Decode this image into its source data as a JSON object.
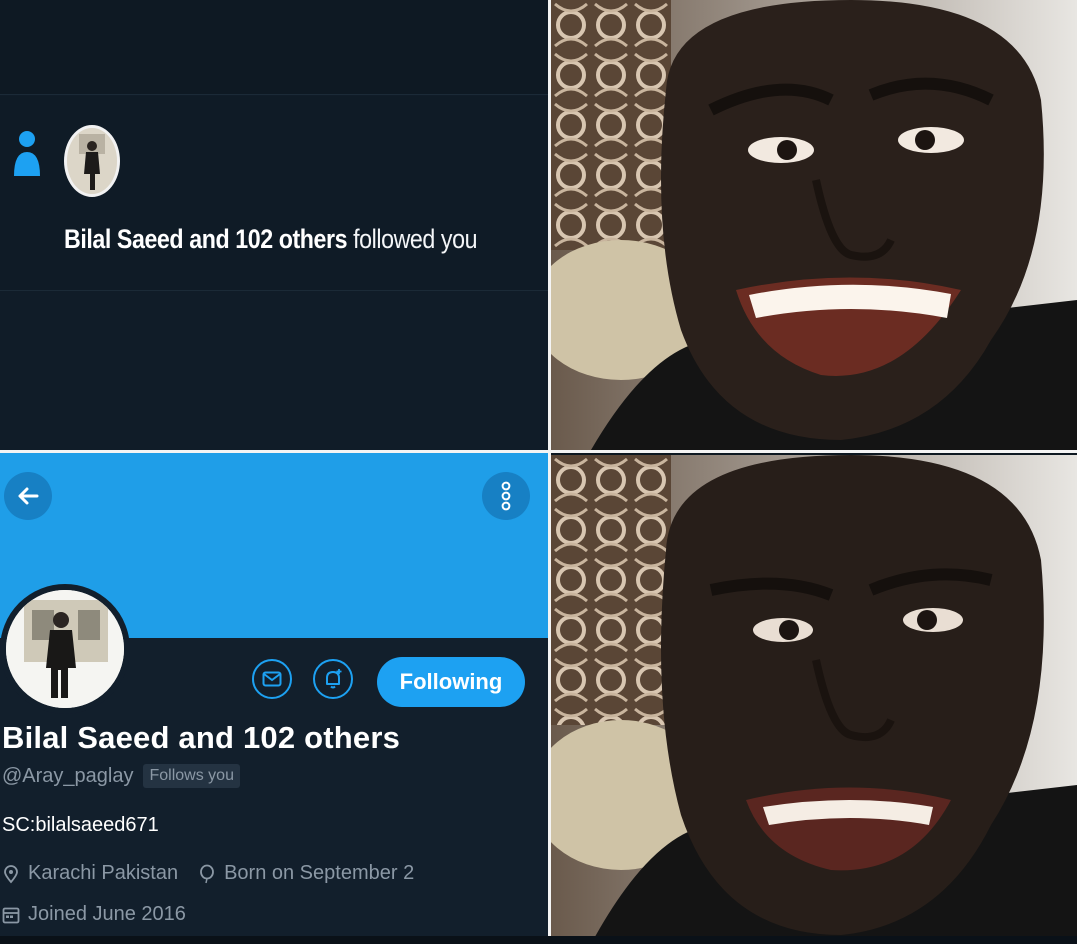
{
  "notification": {
    "name": "Bilal Saeed",
    "connector": "and",
    "count_text": "102 others",
    "action": "followed you"
  },
  "profile": {
    "following_label": "Following",
    "display_name": "Bilal Saeed and 102 others",
    "handle": "@Aray_paglay",
    "follows_you": "Follows you",
    "bio": "SC:bilalsaeed671",
    "location": "Karachi Pakistan",
    "birthday": "Born on September 2",
    "joined": "Joined June 2016"
  },
  "icons": {
    "notification_type": "person-icon",
    "back": "arrow-left-icon",
    "more": "more-vertical-icon",
    "message": "mail-icon",
    "notify": "bell-plus-icon",
    "location": "location-pin-icon",
    "birthday": "balloon-icon",
    "joined": "calendar-icon"
  },
  "colors": {
    "accent": "#1da1f2",
    "banner": "#1f9ee8",
    "background": "#121f2c",
    "secondary_text": "#8b98a5"
  }
}
